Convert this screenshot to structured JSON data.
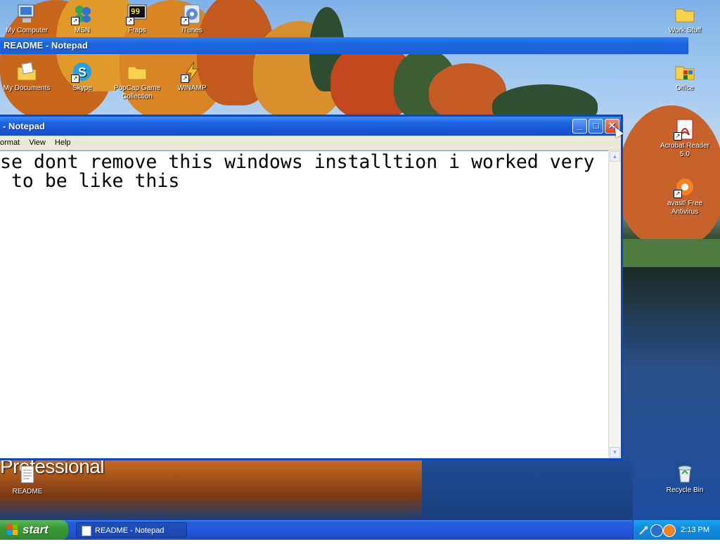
{
  "ghost_window": {
    "title": "README - Notepad"
  },
  "notepad": {
    "title": "- Notepad",
    "menu": [
      "ormat",
      "View",
      "Help"
    ],
    "text": "se dont remove this windows installtion i worked very\n to be like this"
  },
  "desktop": {
    "background_brand_text": "Professional",
    "icons": [
      {
        "label": "My Computer",
        "icon": "my-computer-icon"
      },
      {
        "label": "MSN",
        "icon": "msn-icon"
      },
      {
        "label": "Fraps",
        "icon": "fraps-icon"
      },
      {
        "label": "iTunes",
        "icon": "itunes-icon"
      },
      {
        "label": "Work Stuff",
        "icon": "folder-icon"
      },
      {
        "label": "My Documents",
        "icon": "my-documents-icon"
      },
      {
        "label": "Skype",
        "icon": "skype-icon"
      },
      {
        "label": "PopCap Game Collection",
        "icon": "folder-icon"
      },
      {
        "label": "WINAMP",
        "icon": "winamp-icon"
      },
      {
        "label": "Office",
        "icon": "office-icon"
      },
      {
        "label": "Acrobat Reader 5.0",
        "icon": "acrobat-icon"
      },
      {
        "label": "avast! Free Antivirus",
        "icon": "avast-icon"
      },
      {
        "label": "README",
        "icon": "text-file-icon"
      },
      {
        "label": "Recycle Bin",
        "icon": "recycle-bin-icon"
      }
    ]
  },
  "taskbar": {
    "start_label": "start",
    "tasks": [
      {
        "label": "README - Notepad",
        "icon": "notepad-icon"
      }
    ],
    "clock": "2:13 PM"
  },
  "colors": {
    "title_bar": "#1a63dd",
    "taskbar": "#245edb",
    "start_button": "#3a9a36",
    "tray": "#0f8cdf",
    "close_button": "#d4441e"
  }
}
